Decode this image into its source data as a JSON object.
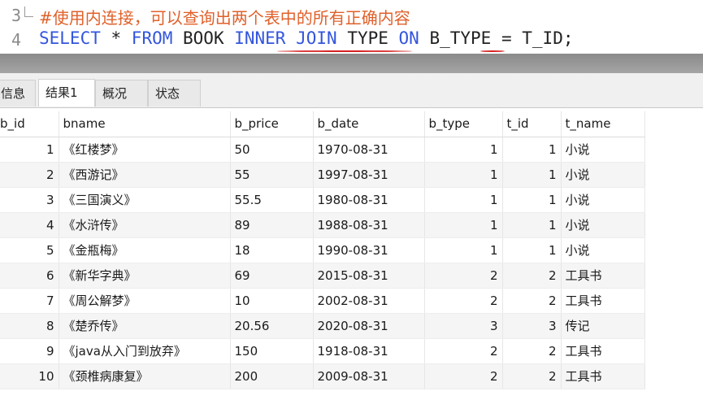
{
  "editor": {
    "lines": [
      {
        "number": "3",
        "comment": "#使用内连接，可以查询出两个表中的所有正确内容"
      },
      {
        "number": "4",
        "tokens": {
          "select": "SELECT",
          "star": " * ",
          "from": "FROM",
          "book": " BOOK ",
          "inner_join": "INNER JOIN",
          "type": " TYPE ",
          "on": "ON",
          "cond": " B_TYPE = T_ID;"
        }
      }
    ]
  },
  "tabs": [
    {
      "label": "信息",
      "active": false
    },
    {
      "label": "结果1",
      "active": true
    },
    {
      "label": "概况",
      "active": false
    },
    {
      "label": "状态",
      "active": false
    }
  ],
  "grid": {
    "columns": [
      "b_id",
      "bname",
      "b_price",
      "b_date",
      "b_type",
      "t_id",
      "t_name"
    ],
    "rows": [
      [
        "1",
        "《红楼梦》",
        "50",
        "1970-08-31",
        "1",
        "1",
        "小说"
      ],
      [
        "2",
        "《西游记》",
        "55",
        "1997-08-31",
        "1",
        "1",
        "小说"
      ],
      [
        "3",
        "《三国演义》",
        "55.5",
        "1980-08-31",
        "1",
        "1",
        "小说"
      ],
      [
        "4",
        "《水浒传》",
        "89",
        "1988-08-31",
        "1",
        "1",
        "小说"
      ],
      [
        "5",
        "《金瓶梅》",
        "18",
        "1990-08-31",
        "1",
        "1",
        "小说"
      ],
      [
        "6",
        "《新华字典》",
        "69",
        "2015-08-31",
        "2",
        "2",
        "工具书"
      ],
      [
        "7",
        "《周公解梦》",
        "10",
        "2002-08-31",
        "2",
        "2",
        "工具书"
      ],
      [
        "8",
        "《楚乔传》",
        "20.56",
        "2020-08-31",
        "3",
        "3",
        "传记"
      ],
      [
        "9",
        "《java从入门到放弃》",
        "150",
        "1918-08-31",
        "2",
        "2",
        "工具书"
      ],
      [
        "10",
        "《颈椎病康复》",
        "200",
        "2009-08-31",
        "2",
        "2",
        "工具书"
      ]
    ]
  },
  "colors": {
    "keyword": "#3355dd",
    "comment": "#e0602a",
    "underline": "#d62020"
  }
}
